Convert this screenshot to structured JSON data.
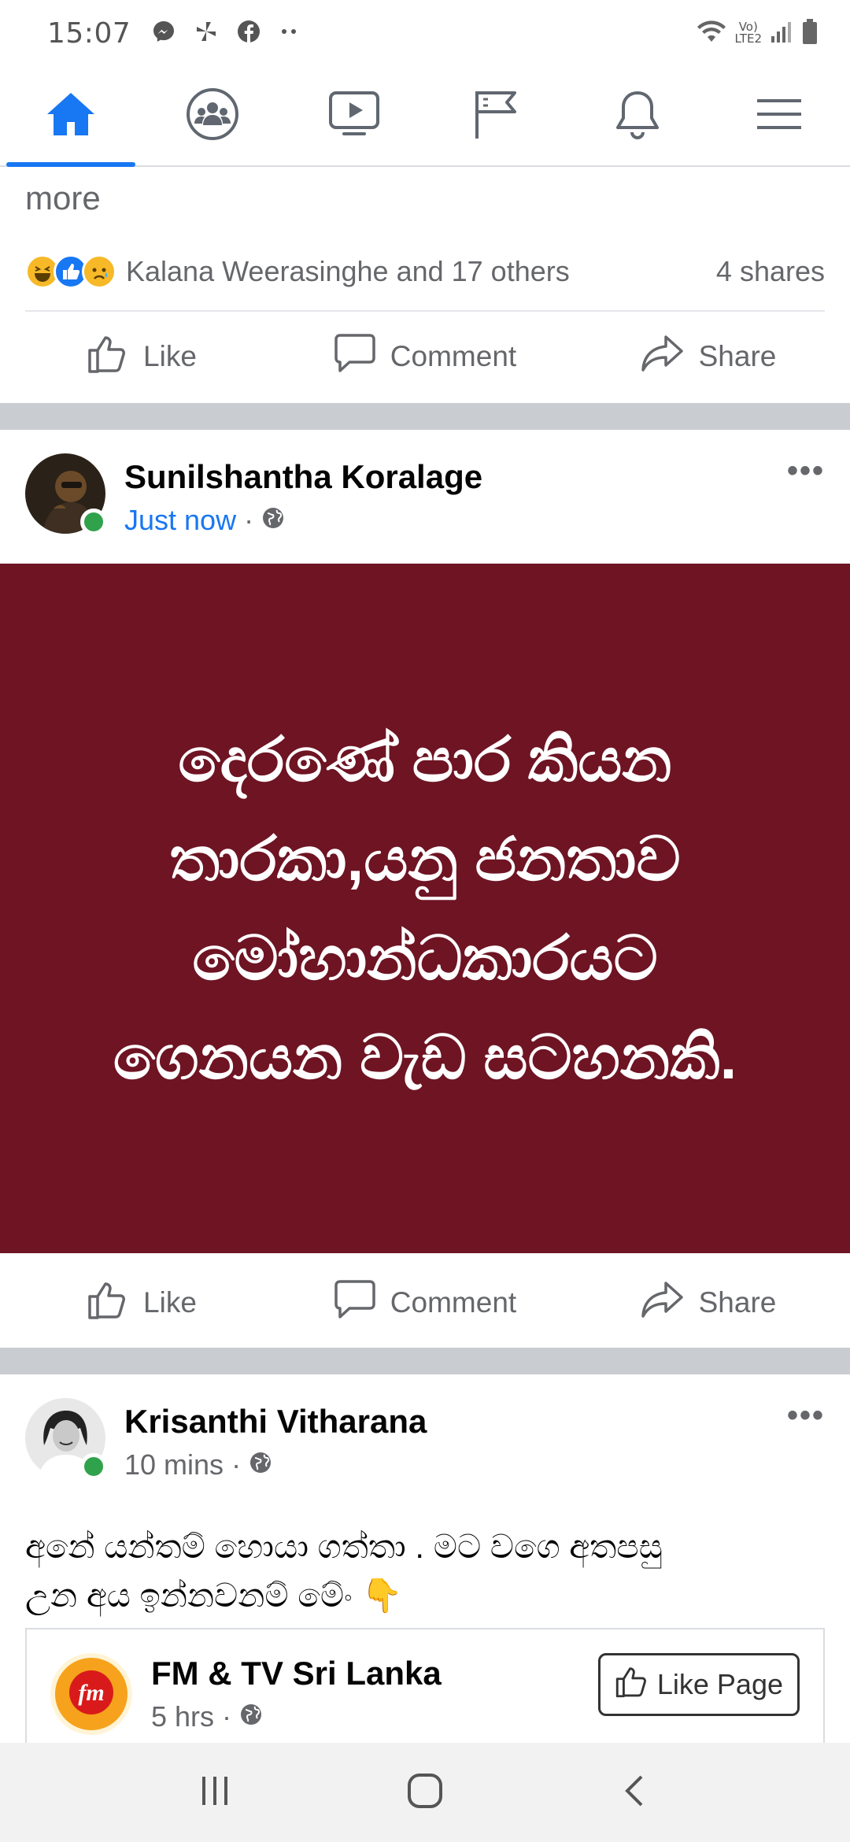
{
  "status_bar": {
    "time": "15:07",
    "network_label_top": "Vo)",
    "network_label_bottom": "LTE2",
    "notification_icons": [
      "messenger-icon",
      "pinwheel-icon",
      "facebook-icon",
      "more-dots-icon"
    ]
  },
  "top_nav": {
    "tabs": [
      "home",
      "groups",
      "watch",
      "pages",
      "notifications",
      "menu"
    ],
    "active_tab": "home",
    "accent_color": "#1877f2"
  },
  "previous_post": {
    "more_text": "more",
    "reactions_text": "Kalana Weerasinghe and 17 others",
    "shares_text": "4 shares",
    "reaction_types": [
      "haha",
      "like",
      "sad"
    ]
  },
  "actions": {
    "like": "Like",
    "comment": "Comment",
    "share": "Share"
  },
  "post1": {
    "author": "Sunilshantha Koralage",
    "time": "Just now",
    "privacy_icon": "globe-icon",
    "card_text": "දෙරණේ පාර කියන තාරකා,යනු ජනතාව මෝහාන්ධකාරයට ගෙනයන වැඩ සටහනකි.",
    "card_color": "#6e1423"
  },
  "post2": {
    "author": "Krisanthi Vitharana",
    "time": "10 mins",
    "privacy_icon": "globe-icon",
    "text_line1": "අනේ යන්තම් හොයා ගත්තා . මට වගෙ අතපසු",
    "text_line2": "උන අය ඉන්නවනම් මේං 👇"
  },
  "shared_page": {
    "name": "FM & TV Sri Lanka",
    "time": "5 hrs",
    "like_page_label": "Like Page"
  },
  "system_nav": [
    "recent-apps",
    "home",
    "back"
  ]
}
